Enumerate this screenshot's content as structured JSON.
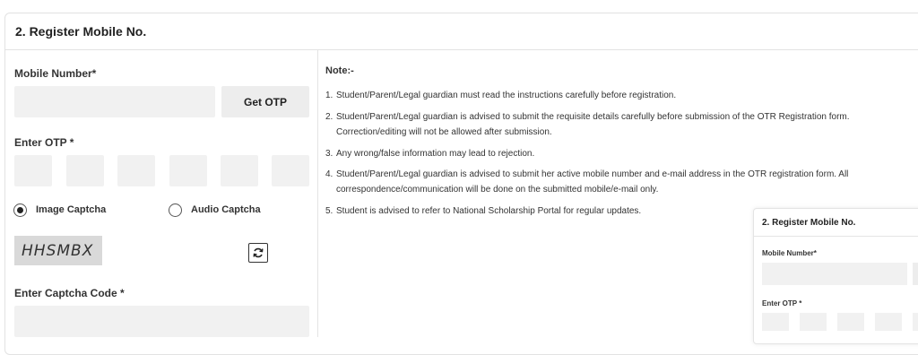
{
  "section": {
    "title": "2. Register Mobile No."
  },
  "form": {
    "mobile_label": "Mobile Number*",
    "mobile_value": "",
    "get_otp_label": "Get OTP",
    "otp_label": "Enter OTP *",
    "otp_digits": [
      "",
      "",
      "",
      "",
      "",
      ""
    ],
    "captcha_options": [
      {
        "label": "Image Captcha",
        "selected": true
      },
      {
        "label": "Audio Captcha",
        "selected": false
      }
    ],
    "captcha_text": "HHSMBX",
    "refresh_icon": "refresh-icon",
    "captcha_code_label": "Enter Captcha Code *",
    "captcha_code_value": ""
  },
  "notes": {
    "title": "Note:-",
    "items": [
      {
        "num": "1.",
        "line1": "Student/Parent/Legal guardian must read the instructions carefully before registration.",
        "line2": ""
      },
      {
        "num": "2.",
        "line1": "Student/Parent/Legal guardian is advised to submit the requisite details carefully before submission of the OTR Registration form.",
        "line2": "Correction/editing will not be allowed after submission."
      },
      {
        "num": "3.",
        "line1": "Any wrong/false information may lead to rejection.",
        "line2": ""
      },
      {
        "num": "4.",
        "line1": "Student/Parent/Legal guardian is advised to submit her active mobile number and e-mail address in the OTR registration form. All",
        "line2": "correspondence/communication will be done on the submitted mobile/e-mail only."
      },
      {
        "num": "5.",
        "line1": "Student is advised to refer to National Scholarship Portal for regular updates.",
        "line2": ""
      }
    ]
  },
  "preview": {
    "title": "2. Register Mobile No.",
    "mobile_label": "Mobile Number*",
    "otp_label": "Enter OTP *"
  }
}
